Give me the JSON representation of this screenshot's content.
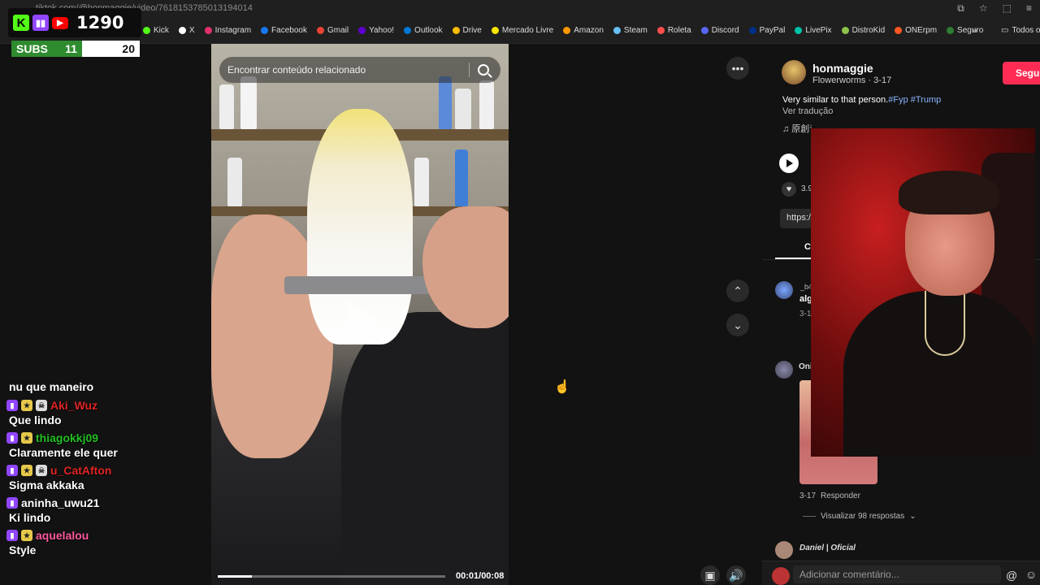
{
  "browser": {
    "url": "tiktok.com/@honmaggie/video/7618153785013194014",
    "bookmarks": [
      "Kick",
      "X",
      "Instagram",
      "Facebook",
      "Gmail",
      "Yahoo!",
      "Outlook",
      "Drive",
      "Mercado Livre",
      "Amazon",
      "Steam",
      "Roleta",
      "Discord",
      "PayPal",
      "LivePix",
      "DistroKid",
      "ONErpm",
      "Seguro"
    ],
    "bookmark_colors": [
      "#53fc18",
      "#ffffff",
      "#e1306c",
      "#1877f2",
      "#ea4335",
      "#6001d2",
      "#0078d4",
      "#fbbc04",
      "#ffe600",
      "#ff9900",
      "#66c0f4",
      "#ff4d4d",
      "#5865f2",
      "#003087",
      "#00c2a8",
      "#8bc34a",
      "#ff5722",
      "#2e7d32"
    ],
    "all_bookmarks": "Todos os"
  },
  "overlay": {
    "viewer_count": "1290",
    "subs_label": "SUBS",
    "subs_current": "11",
    "subs_goal": "20",
    "subs_progress": 0.55
  },
  "chat": {
    "first_line": "nu que maneiro",
    "messages": [
      {
        "user": "Aki_Wuz",
        "color": "#e02424",
        "text": "Que lindo"
      },
      {
        "user": "thiagokkj09",
        "color": "#22c022",
        "text": "Claramente ele quer"
      },
      {
        "user": "u_CatAfton",
        "color": "#e02424",
        "text": "Sigma akkaka"
      },
      {
        "user": "aninha_uwu21",
        "color": "#ffffff",
        "text": "Ki lindo"
      },
      {
        "user": "aquelalou",
        "color": "#ff5aa0",
        "text": "Style"
      }
    ]
  },
  "video": {
    "search_placeholder": "Encontrar conteúdo relacionado",
    "time": "00:01/00:08",
    "progress": 0.15
  },
  "panel": {
    "author": "honmaggie",
    "author_meta": "Flowerworms · 3-17",
    "follow": "Segui",
    "caption_text": "Very similar to that person.",
    "caption_tags": "#Fyp #Trump",
    "translate": "Ver tradução",
    "music": "♫ 原創音樂 - Flowerworms",
    "likes": "3.9",
    "link": "https:/",
    "tab": "C",
    "comment1": {
      "name": "_b4",
      "text": "alg",
      "date": "3-1"
    },
    "comment2": {
      "name": "Oni",
      "date": "3-17",
      "reply": "Responder"
    },
    "view_replies": "Visualizar 98 respostas",
    "comment3_name": "Daniel | Oficial",
    "comment_placeholder": "Adicionar comentário..."
  }
}
